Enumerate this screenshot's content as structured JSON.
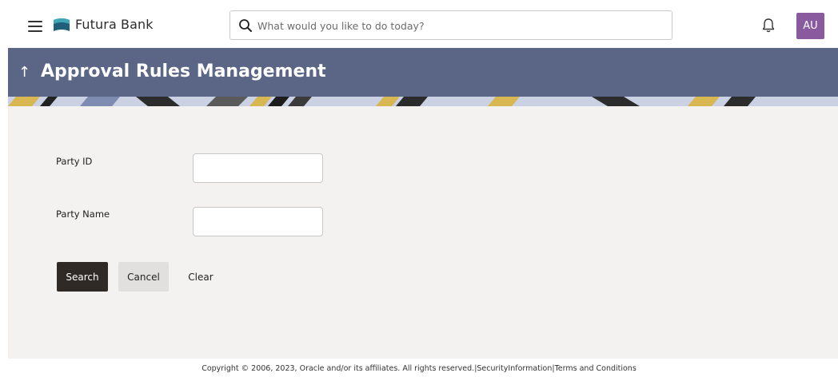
{
  "header": {
    "menu_icon": "hamburger-menu-icon",
    "brand_name": "Futura Bank",
    "search_placeholder": "What would you like to do today?",
    "notification_icon": "bell-icon",
    "user_initials": "AU",
    "avatar_color": "#8a5a9f"
  },
  "page": {
    "title": "Approval Rules Management",
    "back_icon": "up-arrow-icon",
    "banner_color": "#5b6586"
  },
  "form": {
    "party_id_label": "Party ID",
    "party_id_value": "",
    "party_name_label": "Party Name",
    "party_name_value": "",
    "search_label": "Search",
    "cancel_label": "Cancel",
    "clear_label": "Clear"
  },
  "footer": {
    "copyright": "Copyright © 2006, 2023, Oracle and/or its affiliates. All rights reserved.",
    "separator": "|",
    "security_label": "SecurityInformation",
    "terms_label": "Terms and Conditions"
  }
}
